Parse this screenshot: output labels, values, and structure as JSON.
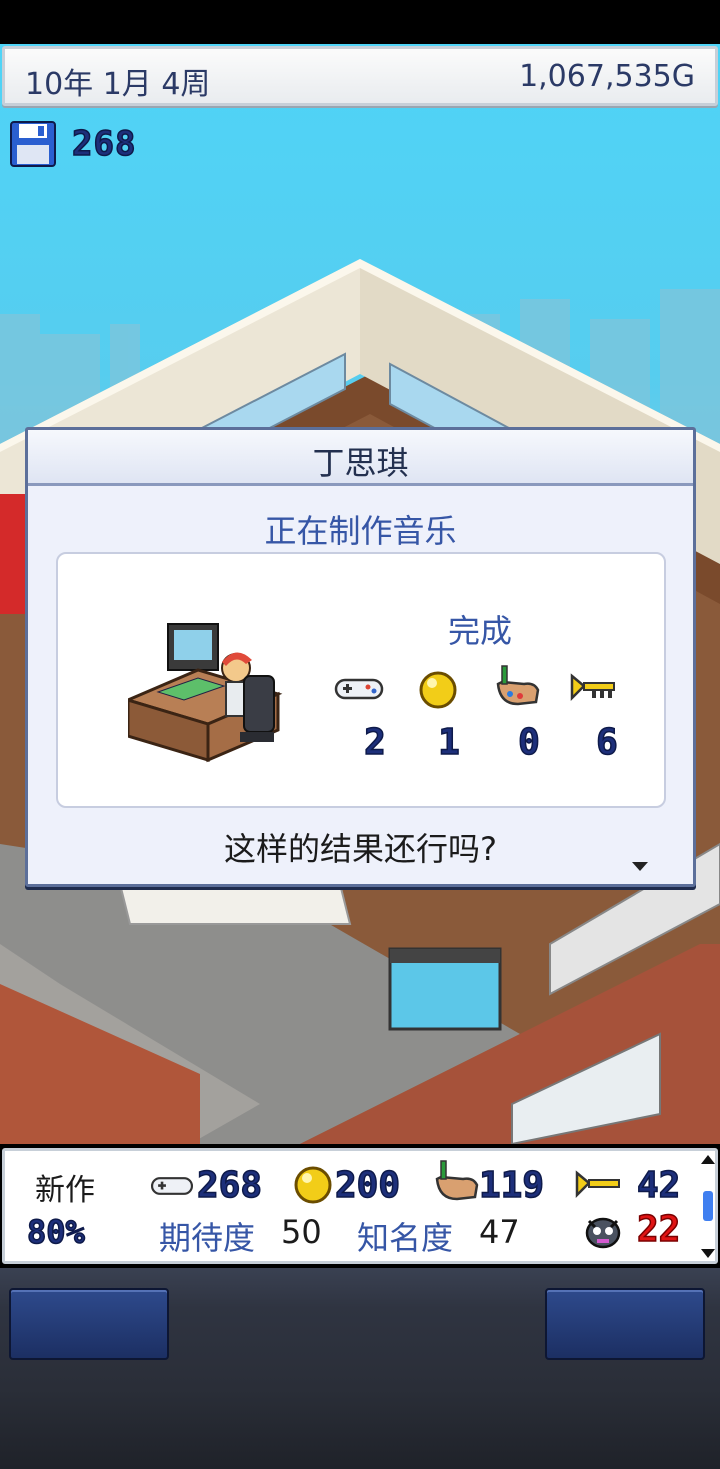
{
  "status_bar": {
    "date": "10年 1月 4周",
    "money": "1,067,535G"
  },
  "save": {
    "icon": "floppy-disk-icon",
    "count": "268"
  },
  "dialog": {
    "name": "丁思琪",
    "task": "正在制作音乐",
    "result_label": "完成",
    "stats": [
      {
        "icon": "controller-icon",
        "value": "2"
      },
      {
        "icon": "gold-orb-icon",
        "value": "1"
      },
      {
        "icon": "paint-palette-icon",
        "value": "0"
      },
      {
        "icon": "trumpet-icon",
        "value": "6"
      }
    ],
    "question": "这样的结果还行吗?"
  },
  "info_bar": {
    "new_label": "新作",
    "progress": "80%",
    "stats": [
      {
        "icon": "controller-icon",
        "value": "268"
      },
      {
        "icon": "gold-orb-icon",
        "value": "200"
      },
      {
        "icon": "paint-palette-icon",
        "value": "119"
      },
      {
        "icon": "trumpet-icon",
        "value": "42"
      }
    ],
    "expectation_label": "期待度",
    "expectation_value": "50",
    "fame_label": "知名度",
    "fame_value": "47",
    "bugs": {
      "icon": "bug-icon",
      "value": "22"
    }
  },
  "colors": {
    "sky": "#4fd4f7",
    "accent_blue": "#3656a6",
    "number_navy": "#1d2f7a",
    "bug_red": "#e01414"
  }
}
